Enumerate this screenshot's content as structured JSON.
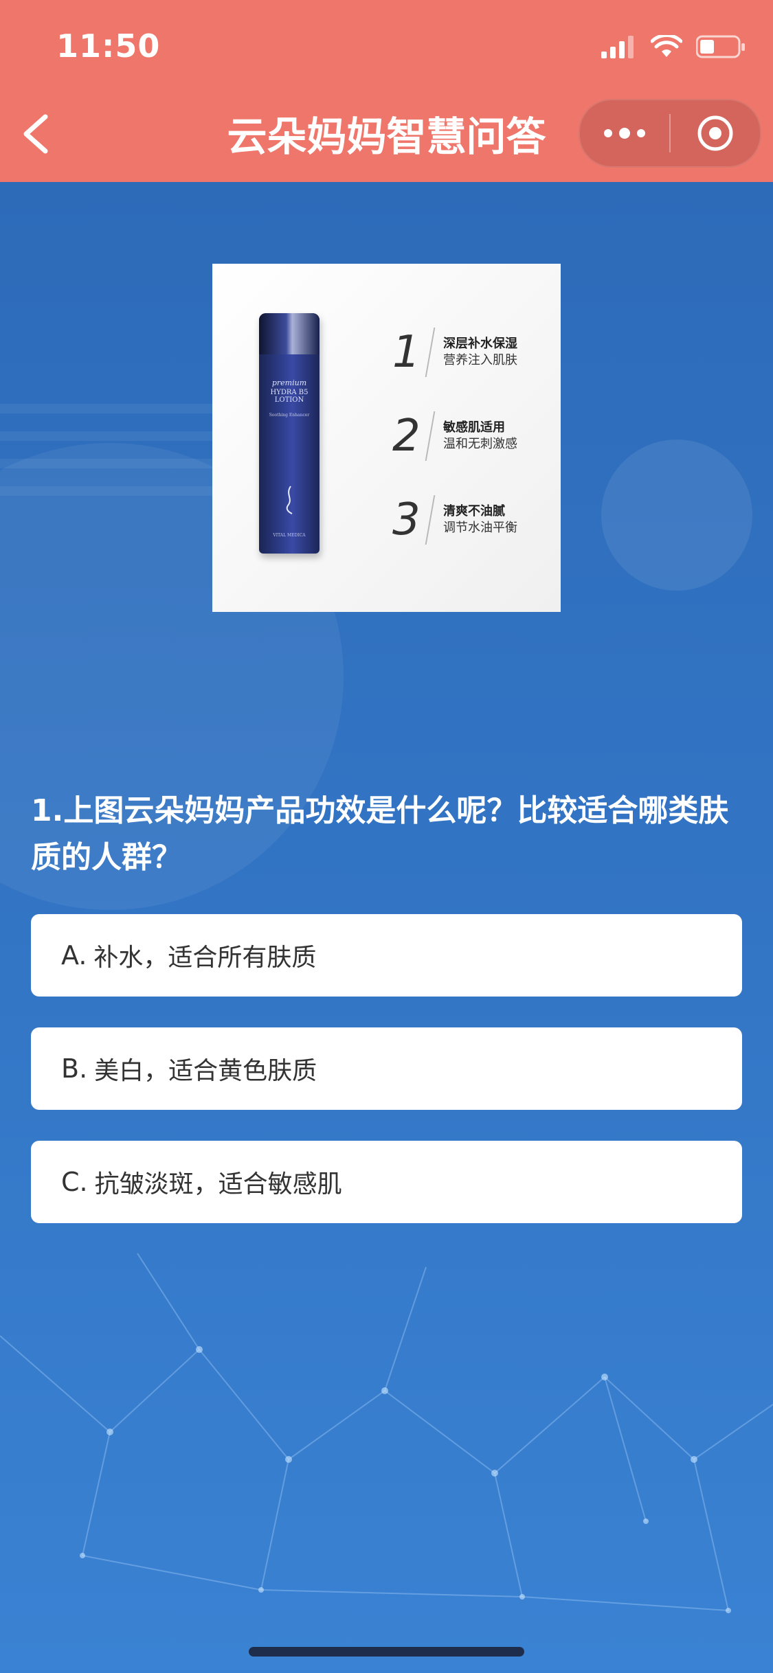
{
  "status_bar": {
    "time": "11:50",
    "icons": [
      "signal-icon",
      "wifi-icon",
      "battery-icon"
    ]
  },
  "nav": {
    "title": "云朵妈妈智慧问答",
    "back_icon": "chevron-left-icon",
    "more_icon": "more-dots-icon",
    "close_icon": "target-close-icon"
  },
  "product_image": {
    "bottle_text": {
      "line1": "premium",
      "line2": "HYDRA B5 LOTION",
      "line3": "Soothing Enhancer",
      "line4": "VITAL MEDICA"
    },
    "features": [
      {
        "num": "1",
        "title": "深层补水保湿",
        "subtitle": "营养注入肌肤"
      },
      {
        "num": "2",
        "title": "敏感肌适用",
        "subtitle": "温和无刺激感"
      },
      {
        "num": "3",
        "title": "清爽不油腻",
        "subtitle": "调节水油平衡"
      }
    ]
  },
  "question": {
    "text": "1.上图云朵妈妈产品功效是什么呢？比较适合哪类肤质的人群？",
    "options": [
      {
        "letter": "A.",
        "text": "补水，适合所有肤质"
      },
      {
        "letter": "B.",
        "text": "美白，适合黄色肤质"
      },
      {
        "letter": "C.",
        "text": "抗皱淡斑，适合敏感肌"
      }
    ]
  },
  "colors": {
    "topbar": "#ef766b",
    "background": "#3173c3",
    "card": "#ffffff",
    "question_text": "#ffffff"
  }
}
